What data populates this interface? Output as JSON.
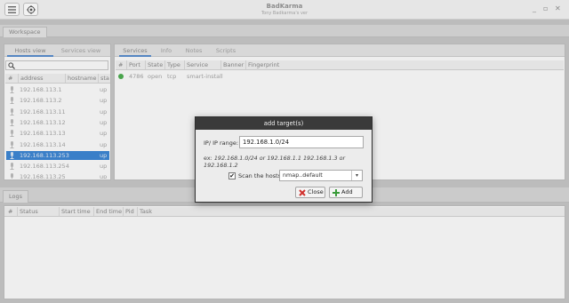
{
  "window": {
    "title": "BadKarma",
    "subtitle": "Tony Badkarma's ver"
  },
  "workspace_tab": "Workspace",
  "hosts_panel": {
    "tabs": [
      "Hosts view",
      "Services view"
    ],
    "columns": [
      "#",
      "address",
      "hostname",
      "sta"
    ],
    "rows": [
      {
        "address": "192.168.113.1",
        "status": "up"
      },
      {
        "address": "192.168.113.2",
        "status": "up"
      },
      {
        "address": "192.168.113.11",
        "status": "up"
      },
      {
        "address": "192.168.113.12",
        "status": "up"
      },
      {
        "address": "192.168.113.13",
        "status": "up"
      },
      {
        "address": "192.168.113.14",
        "status": "up"
      },
      {
        "address": "192.168.113.253",
        "status": "up",
        "selected": true
      },
      {
        "address": "192.168.113.254",
        "status": "up"
      },
      {
        "address": "192.168.113.25",
        "status": "up"
      }
    ]
  },
  "services_panel": {
    "tabs": [
      "Services",
      "Info",
      "Notes",
      "Scripts"
    ],
    "columns": [
      "#",
      "Port",
      "State",
      "Type",
      "Service",
      "Banner",
      "Fingerprint"
    ],
    "rows": [
      {
        "port": "4786",
        "state": "open",
        "type": "tcp",
        "service": "smart-install",
        "status_color": "#4caf50"
      }
    ]
  },
  "logs": {
    "tab": "Logs",
    "columns": [
      "#",
      "Status",
      "Start time",
      "End time",
      "Pid",
      "Task"
    ]
  },
  "dialog": {
    "title": "add target(s)",
    "ip_label": "IP/ IP range:",
    "ip_value": "192.168.1.0/24",
    "example_prefix": "ex:",
    "example_text": "192.168.1.0/24 or 192.168.1.1 192.168.1.3 or 192.168.1.2",
    "scan_label": "Scan the hosts",
    "scan_checked": "✔",
    "scan_profile": "nmap..default",
    "close_label": "Close",
    "add_label": "Add"
  }
}
